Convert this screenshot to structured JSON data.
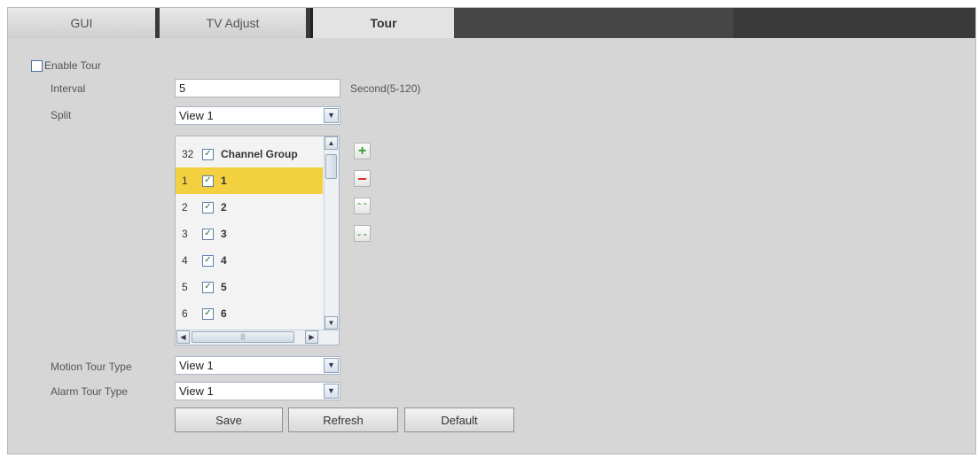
{
  "tabs": [
    {
      "label": "GUI",
      "active": false
    },
    {
      "label": "TV Adjust",
      "active": false
    },
    {
      "label": "Tour",
      "active": true
    }
  ],
  "form": {
    "enable_tour": {
      "label": "Enable Tour",
      "checked": false
    },
    "interval": {
      "label": "Interval",
      "value": "5",
      "hint": "Second(5-120)"
    },
    "split": {
      "label": "Split",
      "selected": "View 1"
    },
    "motion_tour_type": {
      "label": "Motion Tour Type",
      "selected": "View 1"
    },
    "alarm_tour_type": {
      "label": "Alarm Tour Type",
      "selected": "View 1"
    }
  },
  "channel_list": {
    "header": {
      "num": "32",
      "label": "Channel Group",
      "checked": true
    },
    "rows": [
      {
        "num": "1",
        "label": "1",
        "checked": true,
        "selected": true
      },
      {
        "num": "2",
        "label": "2",
        "checked": true,
        "selected": false
      },
      {
        "num": "3",
        "label": "3",
        "checked": true,
        "selected": false
      },
      {
        "num": "4",
        "label": "4",
        "checked": true,
        "selected": false
      },
      {
        "num": "5",
        "label": "5",
        "checked": true,
        "selected": false
      },
      {
        "num": "6",
        "label": "6",
        "checked": true,
        "selected": false
      }
    ]
  },
  "side_buttons": {
    "add": "+",
    "remove": "−",
    "move_up": "⌃⌃",
    "move_down": "⌄⌄"
  },
  "buttons": {
    "save": "Save",
    "refresh": "Refresh",
    "default": "Default"
  },
  "colors": {
    "selected_row": "#f3d03f",
    "add": "#2e9e2e",
    "remove": "#d63030",
    "arrows": "#3a9e3a"
  }
}
